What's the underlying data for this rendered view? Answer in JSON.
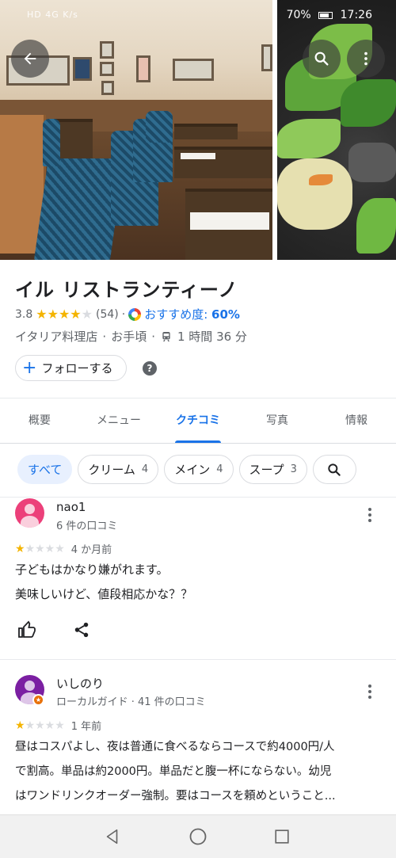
{
  "status_bar": {
    "left": "HD 4G K/s",
    "battery": "70%",
    "time": "17:26"
  },
  "place": {
    "name": "イル リストランティーノ",
    "rating": "3.8",
    "stars": 4,
    "review_count": "(54)",
    "recommend_label": "おすすめ度:",
    "recommend_value": "60%",
    "category": "イタリア料理店",
    "price": "お手頃",
    "travel_time": "1 時間 36 分",
    "follow_label": "フォローする",
    "help_symbol": "?"
  },
  "tabs": [
    {
      "label": "概要"
    },
    {
      "label": "メニュー"
    },
    {
      "label": "クチコミ",
      "active": true
    },
    {
      "label": "写真"
    },
    {
      "label": "情報"
    }
  ],
  "filters": [
    {
      "label": "すべて",
      "count": ""
    },
    {
      "label": "クリーム",
      "count": "4"
    },
    {
      "label": "メイン",
      "count": "4"
    },
    {
      "label": "スープ",
      "count": "3"
    }
  ],
  "reviews": [
    {
      "author": "nao1",
      "meta": "6 件の口コミ",
      "stars": 1,
      "when": "4 か月前",
      "lines": [
        "子どもはかなり嫌がれます。",
        "美味しいけど、値段相応かな？？"
      ],
      "avatar_color": "#ec407a"
    },
    {
      "author": "いしのり",
      "meta": "ローカルガイド · 41 件の口コミ",
      "stars": 1,
      "when": "1 年前",
      "lines": [
        "昼はコスパよし、夜は普通に食べるならコースで約4000円/人",
        "で割高。単品は約2000円。単品だと腹一杯にならない。幼児",
        "はワンドリンクオーダー強制。要はコースを頼めということ..."
      ],
      "avatar_color": "#7b1fa2"
    }
  ],
  "colors": {
    "accent": "#1a73e8",
    "star": "#f4b400"
  },
  "icons": [
    "back-arrow-icon",
    "search-icon",
    "more-vert-icon",
    "plus-icon",
    "help-icon",
    "transit-icon",
    "like-icon",
    "share-icon",
    "nav-back-icon",
    "nav-home-icon",
    "nav-recents-icon"
  ]
}
